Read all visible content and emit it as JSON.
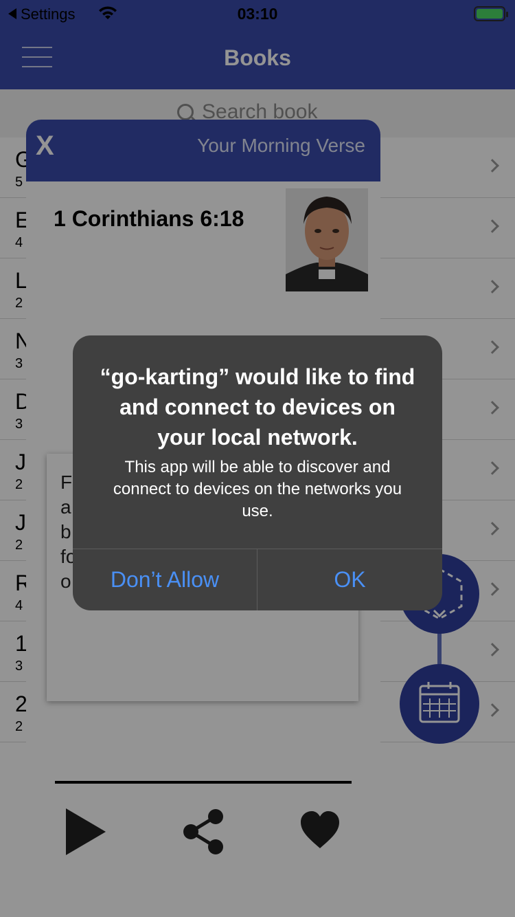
{
  "status_bar": {
    "back_label": "Settings",
    "time": "03:10"
  },
  "header": {
    "title": "Books"
  },
  "search": {
    "placeholder": "Search book"
  },
  "books": [
    {
      "name": "G",
      "count": "5"
    },
    {
      "name": "E",
      "count": "4"
    },
    {
      "name": "L",
      "count": "2"
    },
    {
      "name": "N",
      "count": "3"
    },
    {
      "name": "D",
      "count": "3"
    },
    {
      "name": "J",
      "count": "2"
    },
    {
      "name": "J",
      "count": "2"
    },
    {
      "name": "R",
      "count": "4"
    },
    {
      "name": "1",
      "count": "3"
    },
    {
      "name": "2",
      "count": "2"
    }
  ],
  "verse_card": {
    "close_label": "X",
    "title": "Your Morning Verse",
    "reference": "1 Corinthians 6:18",
    "text_lines": [
      "F",
      "a",
      "b",
      "fo",
      "o"
    ]
  },
  "alert": {
    "title": "“go-karting” would like to find and connect to devices on your local network.",
    "message": "This app will be able to discover and connect to devices on the networks you use.",
    "deny_label": "Don’t Allow",
    "ok_label": "OK"
  },
  "colors": {
    "primary": "#3a4bab",
    "alert_bg": "#404040",
    "alert_button": "#4a90f5"
  },
  "icons": [
    "back-arrow-icon",
    "wifi-icon",
    "battery-icon",
    "hamburger-menu-icon",
    "search-icon",
    "chevron-right-icon",
    "cube-icon",
    "calendar-icon",
    "play-icon",
    "share-icon",
    "heart-icon"
  ]
}
